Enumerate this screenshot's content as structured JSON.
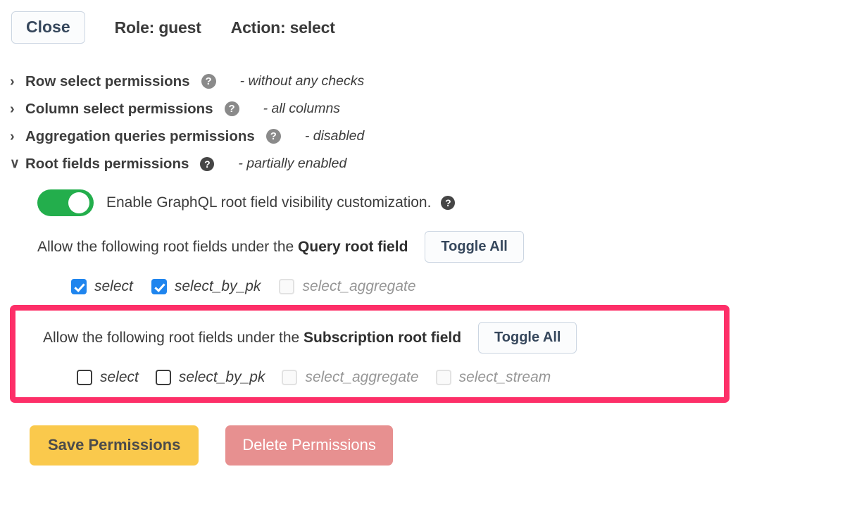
{
  "header": {
    "close_label": "Close",
    "role_label": "Role: guest",
    "action_label": "Action: select",
    "help_glyph": "?"
  },
  "permissions": {
    "sections": [
      {
        "chevron": "›",
        "title": "Row select permissions",
        "status": "- without any checks",
        "expanded": false
      },
      {
        "chevron": "›",
        "title": "Column select permissions",
        "status": "- all columns",
        "expanded": false
      },
      {
        "chevron": "›",
        "title": "Aggregation queries permissions",
        "status": "- disabled",
        "expanded": false
      },
      {
        "chevron": "∨",
        "title": "Root fields permissions",
        "status": "- partially enabled",
        "expanded": true
      }
    ]
  },
  "root_fields": {
    "switch": {
      "label": "Enable GraphQL root field visibility customization.",
      "state": "on"
    },
    "query": {
      "allow_prefix": "Allow the following root fields under the ",
      "allow_bold": "Query root field",
      "toggle_all_label": "Toggle All",
      "fields": [
        {
          "name": "select",
          "checked": true,
          "disabled": false
        },
        {
          "name": "select_by_pk",
          "checked": true,
          "disabled": false
        },
        {
          "name": "select_aggregate",
          "checked": false,
          "disabled": true
        }
      ]
    },
    "subscription": {
      "allow_prefix": "Allow the following root fields under the ",
      "allow_bold": "Subscription root field",
      "toggle_all_label": "Toggle All",
      "highlighted": true,
      "fields": [
        {
          "name": "select",
          "checked": false,
          "disabled": false
        },
        {
          "name": "select_by_pk",
          "checked": false,
          "disabled": false
        },
        {
          "name": "select_aggregate",
          "checked": false,
          "disabled": true
        },
        {
          "name": "select_stream",
          "checked": false,
          "disabled": true
        }
      ]
    }
  },
  "footer": {
    "save_label": "Save Permissions",
    "delete_label": "Delete Permissions"
  },
  "colors": {
    "highlight": "#fd2f68",
    "switch_on": "#23ae4c",
    "checkbox_checked": "#1f85ee",
    "save": "#fac94c",
    "delete": "#e79090",
    "button_border": "#ccd6e2",
    "button_text": "#36475c"
  }
}
